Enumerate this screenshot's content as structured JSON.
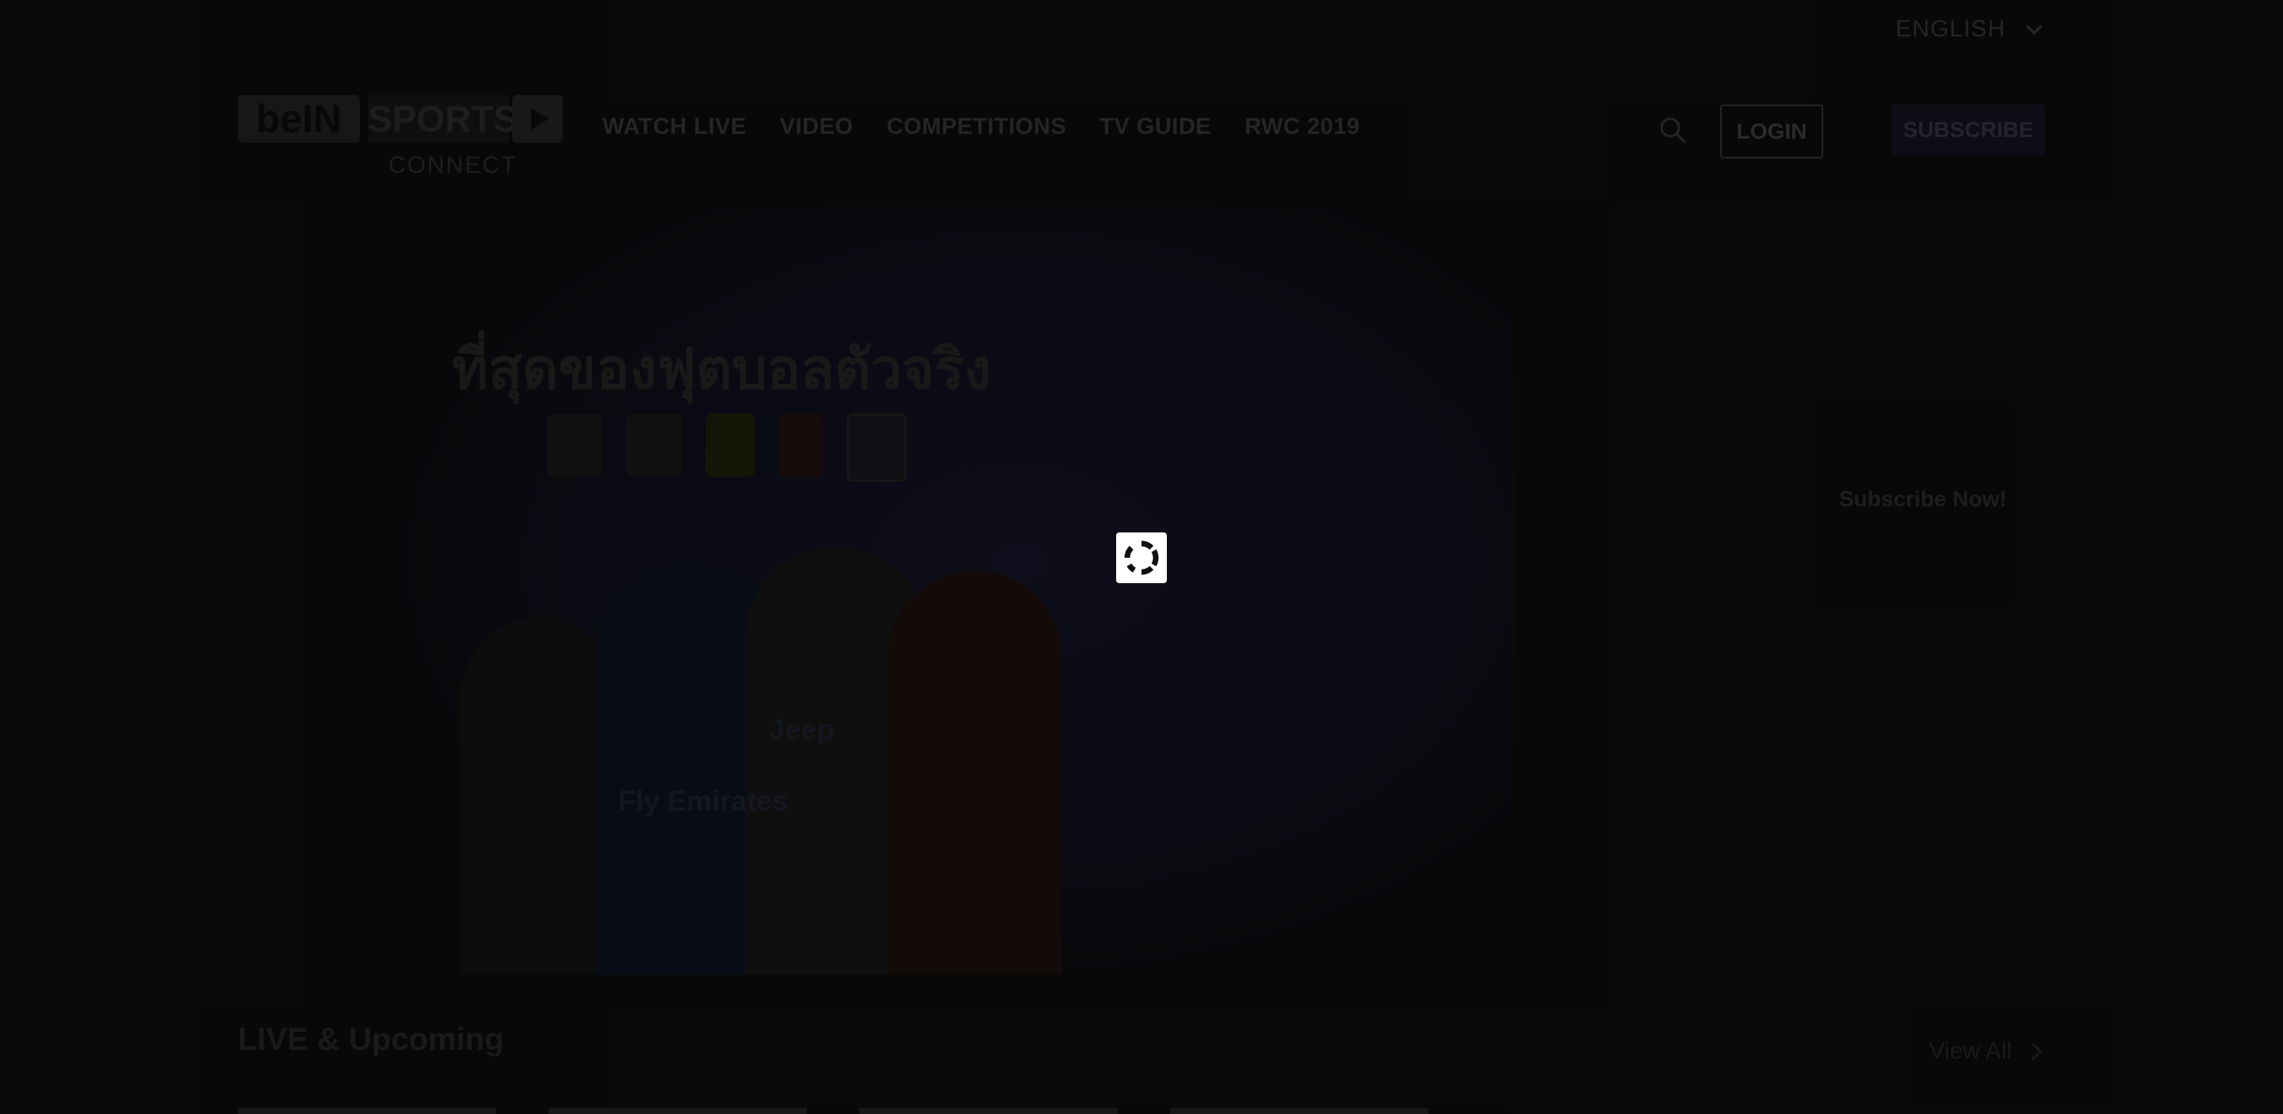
{
  "language": {
    "selected": "ENGLISH",
    "icon": "chevron-down-icon"
  },
  "brand": {
    "logo_bein": "beIN",
    "logo_sports": "SPORTS",
    "logo_connect": "CONNECT"
  },
  "nav": {
    "items": [
      {
        "label": "WATCH LIVE"
      },
      {
        "label": "VIDEO"
      },
      {
        "label": "COMPETITIONS"
      },
      {
        "label": "TV GUIDE"
      },
      {
        "label": "RWC 2019"
      }
    ]
  },
  "header": {
    "search_icon": "search-icon",
    "login_label": "LOGIN",
    "subscribe_label": "SUBSCRIBE"
  },
  "hero": {
    "headline": "ที่สุดของฟุตบอลตัวจริง",
    "jersey_1": "Fly Emirates",
    "jersey_2": "Jeep"
  },
  "sidebar": {
    "subscribe_now": "Subscribe Now!"
  },
  "live_section": {
    "title": "LIVE & Upcoming",
    "view_all": "View All"
  },
  "loading": {
    "icon": "loading-spinner-icon"
  },
  "colors": {
    "background": "#0a0a0a",
    "overlay": "#000000",
    "spinner_bg": "#ffffff"
  }
}
